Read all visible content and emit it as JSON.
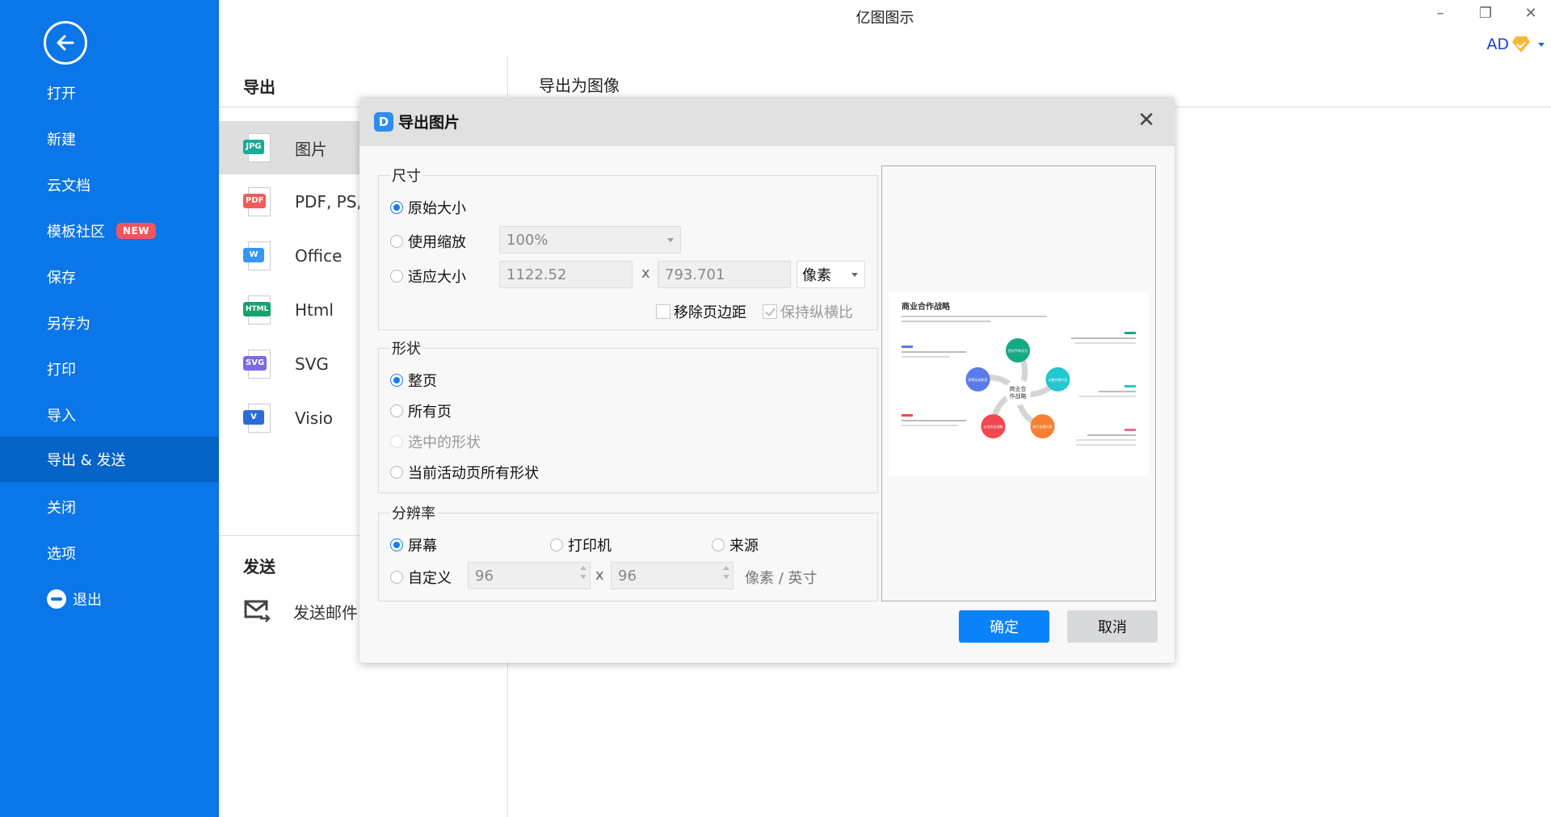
{
  "window": {
    "title": "亿图图示",
    "minimize_icon": "minimize-icon",
    "restore_icon": "restore-icon",
    "close_icon": "close-icon",
    "user_initials": "AD"
  },
  "sidebar": {
    "back_icon": "arrow-left-circle-icon",
    "items": [
      {
        "label": "打开"
      },
      {
        "label": "新建"
      },
      {
        "label": "云文档"
      },
      {
        "label": "模板社区",
        "badge": "NEW"
      },
      {
        "label": "保存"
      },
      {
        "label": "另存为"
      },
      {
        "label": "打印"
      },
      {
        "label": "导入"
      },
      {
        "label": "导出 & 发送",
        "active": true
      },
      {
        "label": "关闭"
      },
      {
        "label": "选项"
      },
      {
        "label": "退出",
        "icon": "minus-circle-icon"
      }
    ]
  },
  "export_panel": {
    "export_heading": "导出",
    "formats": [
      {
        "label": "图片",
        "tag": "JPG",
        "color": "#1aab97",
        "active": true
      },
      {
        "label": "PDF, PS, EPS",
        "tag": "PDF",
        "color": "#f35b5b"
      },
      {
        "label": "Office",
        "tag": "W",
        "color": "#3596f5"
      },
      {
        "label": "Html",
        "tag": "HTML",
        "color": "#17a26c"
      },
      {
        "label": "SVG",
        "tag": "SVG",
        "color": "#7b6ae6"
      },
      {
        "label": "Visio",
        "tag": "V",
        "color": "#2a6cd6"
      }
    ],
    "send_heading": "发送",
    "send_email": "发送邮件"
  },
  "main": {
    "heading": "导出为图像"
  },
  "dialog": {
    "title": "导出图片",
    "logo": "D",
    "size": {
      "title": "尺寸",
      "original_size": "原始大小",
      "use_zoom": "使用缩放",
      "zoom_value": "100%",
      "fit_size": "适应大小",
      "width": "1122.52",
      "x": "x",
      "height": "793.701",
      "unit": "像素",
      "remove_margin": "移除页边距",
      "keep_ratio": "保持纵横比",
      "selected": "original_size"
    },
    "shape": {
      "title": "形状",
      "options": [
        "整页",
        "所有页",
        "选中的形状",
        "当前活动页所有形状"
      ],
      "selected": 0
    },
    "resolution": {
      "title": "分辨率",
      "screen": "屏幕",
      "printer": "打印机",
      "source": "来源",
      "custom": "自定义",
      "dpi_x": "96",
      "x": "x",
      "dpi_y": "96",
      "unit": "像素 / 英寸",
      "selected": "screen"
    },
    "preview": {
      "title": "商业合作战略",
      "center": "商业合作战略",
      "nodes": [
        {
          "label": "把对手转化为合作伙伴",
          "color": "#17a983"
        },
        {
          "label": "以整合替代竞争",
          "color": "#22c7d1"
        },
        {
          "label": "新行业模式取胜的产物",
          "color": "#f97f30"
        },
        {
          "label": "走出商业战略竞争的红海",
          "color": "#f3474f"
        },
        {
          "label": "获得业绩和竞争优势的大幅提升",
          "color": "#5a7bea"
        }
      ]
    },
    "ok": "确定",
    "cancel": "取消"
  }
}
